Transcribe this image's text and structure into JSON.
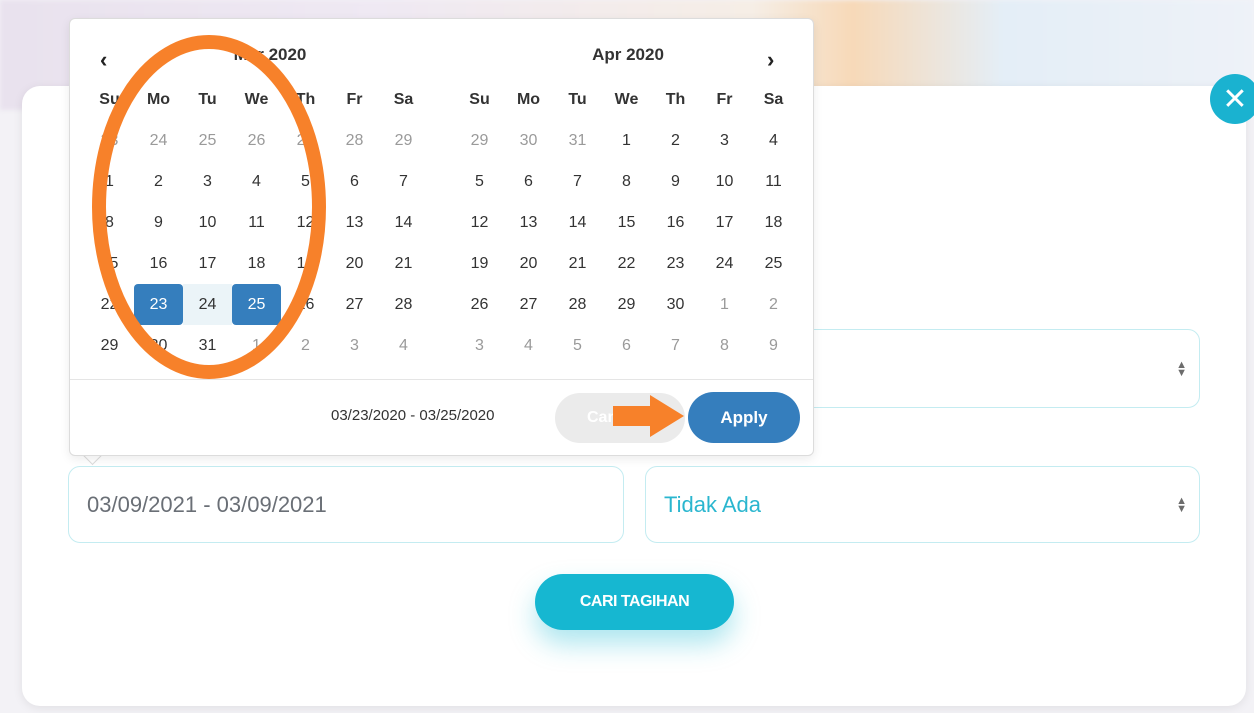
{
  "picker": {
    "prev_icon": "chevron-left-icon",
    "next_icon": "chevron-right-icon",
    "left_title": "Mar 2020",
    "right_title": "Apr 2020",
    "weekdays": [
      "Su",
      "Mo",
      "Tu",
      "We",
      "Th",
      "Fr",
      "Sa"
    ],
    "left_month": [
      [
        {
          "d": "23",
          "s": "off"
        },
        {
          "d": "24",
          "s": "off"
        },
        {
          "d": "25",
          "s": "off"
        },
        {
          "d": "26",
          "s": "off"
        },
        {
          "d": "27",
          "s": "off"
        },
        {
          "d": "28",
          "s": "off"
        },
        {
          "d": "29",
          "s": "off"
        }
      ],
      [
        {
          "d": "1"
        },
        {
          "d": "2"
        },
        {
          "d": "3"
        },
        {
          "d": "4"
        },
        {
          "d": "5"
        },
        {
          "d": "6"
        },
        {
          "d": "7"
        }
      ],
      [
        {
          "d": "8"
        },
        {
          "d": "9"
        },
        {
          "d": "10"
        },
        {
          "d": "11"
        },
        {
          "d": "12"
        },
        {
          "d": "13"
        },
        {
          "d": "14"
        }
      ],
      [
        {
          "d": "15"
        },
        {
          "d": "16"
        },
        {
          "d": "17"
        },
        {
          "d": "18"
        },
        {
          "d": "19"
        },
        {
          "d": "20"
        },
        {
          "d": "21"
        }
      ],
      [
        {
          "d": "22"
        },
        {
          "d": "23",
          "s": "sel"
        },
        {
          "d": "24",
          "s": "range"
        },
        {
          "d": "25",
          "s": "sel"
        },
        {
          "d": "26"
        },
        {
          "d": "27"
        },
        {
          "d": "28"
        }
      ],
      [
        {
          "d": "29"
        },
        {
          "d": "30"
        },
        {
          "d": "31"
        },
        {
          "d": "1",
          "s": "off"
        },
        {
          "d": "2",
          "s": "off"
        },
        {
          "d": "3",
          "s": "off"
        },
        {
          "d": "4",
          "s": "off"
        }
      ]
    ],
    "right_month": [
      [
        {
          "d": "29",
          "s": "off"
        },
        {
          "d": "30",
          "s": "off"
        },
        {
          "d": "31",
          "s": "off"
        },
        {
          "d": "1"
        },
        {
          "d": "2"
        },
        {
          "d": "3"
        },
        {
          "d": "4"
        }
      ],
      [
        {
          "d": "5"
        },
        {
          "d": "6"
        },
        {
          "d": "7"
        },
        {
          "d": "8"
        },
        {
          "d": "9"
        },
        {
          "d": "10"
        },
        {
          "d": "11"
        }
      ],
      [
        {
          "d": "12"
        },
        {
          "d": "13"
        },
        {
          "d": "14"
        },
        {
          "d": "15"
        },
        {
          "d": "16"
        },
        {
          "d": "17"
        },
        {
          "d": "18"
        }
      ],
      [
        {
          "d": "19"
        },
        {
          "d": "20"
        },
        {
          "d": "21"
        },
        {
          "d": "22"
        },
        {
          "d": "23"
        },
        {
          "d": "24"
        },
        {
          "d": "25"
        }
      ],
      [
        {
          "d": "26"
        },
        {
          "d": "27"
        },
        {
          "d": "28"
        },
        {
          "d": "29"
        },
        {
          "d": "30"
        },
        {
          "d": "1",
          "s": "off"
        },
        {
          "d": "2",
          "s": "off"
        }
      ],
      [
        {
          "d": "3",
          "s": "off"
        },
        {
          "d": "4",
          "s": "off"
        },
        {
          "d": "5",
          "s": "off"
        },
        {
          "d": "6",
          "s": "off"
        },
        {
          "d": "7",
          "s": "off"
        },
        {
          "d": "8",
          "s": "off"
        },
        {
          "d": "9",
          "s": "off"
        }
      ]
    ],
    "range_text": "03/23/2020 - 03/25/2020",
    "cancel_label": "Cancel",
    "apply_label": "Apply"
  },
  "form": {
    "date_value": "03/09/2021 - 03/09/2021",
    "select_value": "Tidak Ada",
    "submit_label": "CARI TAGIHAN"
  },
  "annotation": {
    "color": "#f7812a"
  },
  "colors": {
    "accent": "#16b7d1",
    "selected": "#357ebd"
  }
}
